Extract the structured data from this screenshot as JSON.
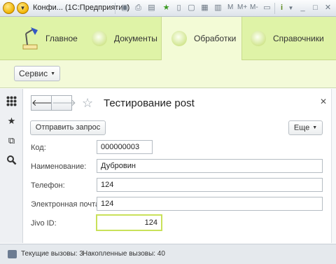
{
  "titlebar": {
    "title": "Конфи... (1С:Предприятие)",
    "m_label": "M",
    "mplus_label": "M+",
    "mminus_label": "M-",
    "info_label": "i"
  },
  "sections": [
    {
      "label": "Главное"
    },
    {
      "label": "Документы"
    },
    {
      "label": "Обработки"
    },
    {
      "label": "Справочники"
    }
  ],
  "commandbar": {
    "service_label": "Сервис"
  },
  "form": {
    "title": "Тестирование post",
    "send_button": "Отправить запрос",
    "more_button": "Еще",
    "fields": [
      {
        "label": "Код:",
        "value": "000000003"
      },
      {
        "label": "Наименование:",
        "value": "Дубровин"
      },
      {
        "label": "Телефон:",
        "value": "124"
      },
      {
        "label": "Электронная почта:",
        "value": "124"
      },
      {
        "label": "Jivo ID:",
        "value": "124"
      }
    ]
  },
  "statusbar": {
    "current_calls": "Текущие вызовы: 3",
    "accumulated_calls": "Накопленные вызовы: 40"
  },
  "colors": {
    "sections_bg": "#dff3a7",
    "active_section_bg": "#f3fbd6",
    "focus_border": "#c9e15a"
  }
}
